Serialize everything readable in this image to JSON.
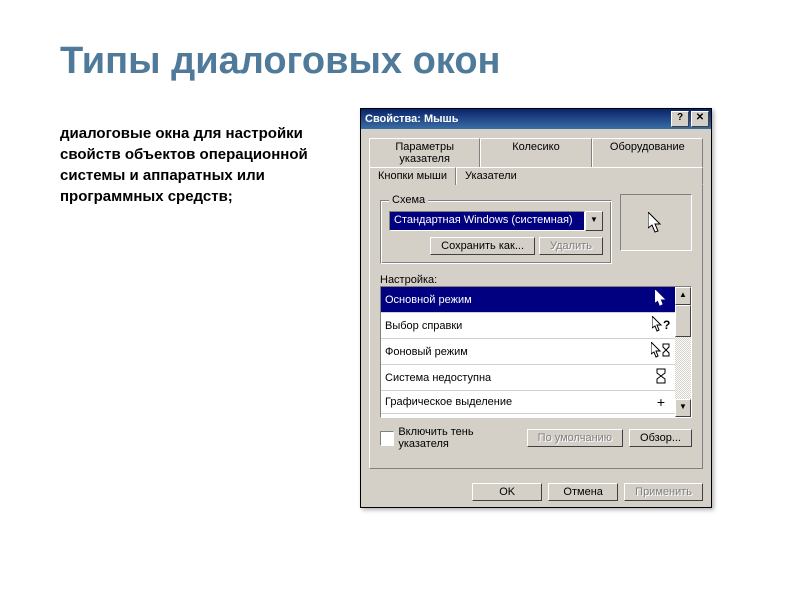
{
  "slide": {
    "title": "Типы диалоговых окон",
    "description": "диалоговые окна для настройки свойств объектов операционной системы и аппаратных или программных средств;"
  },
  "window": {
    "title": "Свойства: Мышь",
    "tabs_back": [
      "Параметры указателя",
      "Колесико",
      "Оборудование"
    ],
    "tabs_front": [
      "Кнопки мыши",
      "Указатели"
    ],
    "active_tab": "Указатели",
    "scheme": {
      "group_title": "Схема",
      "selected": "Стандартная Windows (системная)",
      "save_as": "Сохранить как...",
      "delete": "Удалить"
    },
    "customize": {
      "group_title": "Настройка:",
      "items": [
        {
          "label": "Основной режим",
          "cursor": "arrow"
        },
        {
          "label": "Выбор справки",
          "cursor": "help"
        },
        {
          "label": "Фоновый режим",
          "cursor": "busy-bg"
        },
        {
          "label": "Система недоступна",
          "cursor": "busy"
        },
        {
          "label": "Графическое выделение",
          "cursor": "cross"
        }
      ]
    },
    "shadow_checkbox": "Включить тень указателя",
    "default_btn": "По умолчанию",
    "browse_btn": "Обзор...",
    "ok": "OK",
    "cancel": "Отмена",
    "apply": "Применить"
  }
}
